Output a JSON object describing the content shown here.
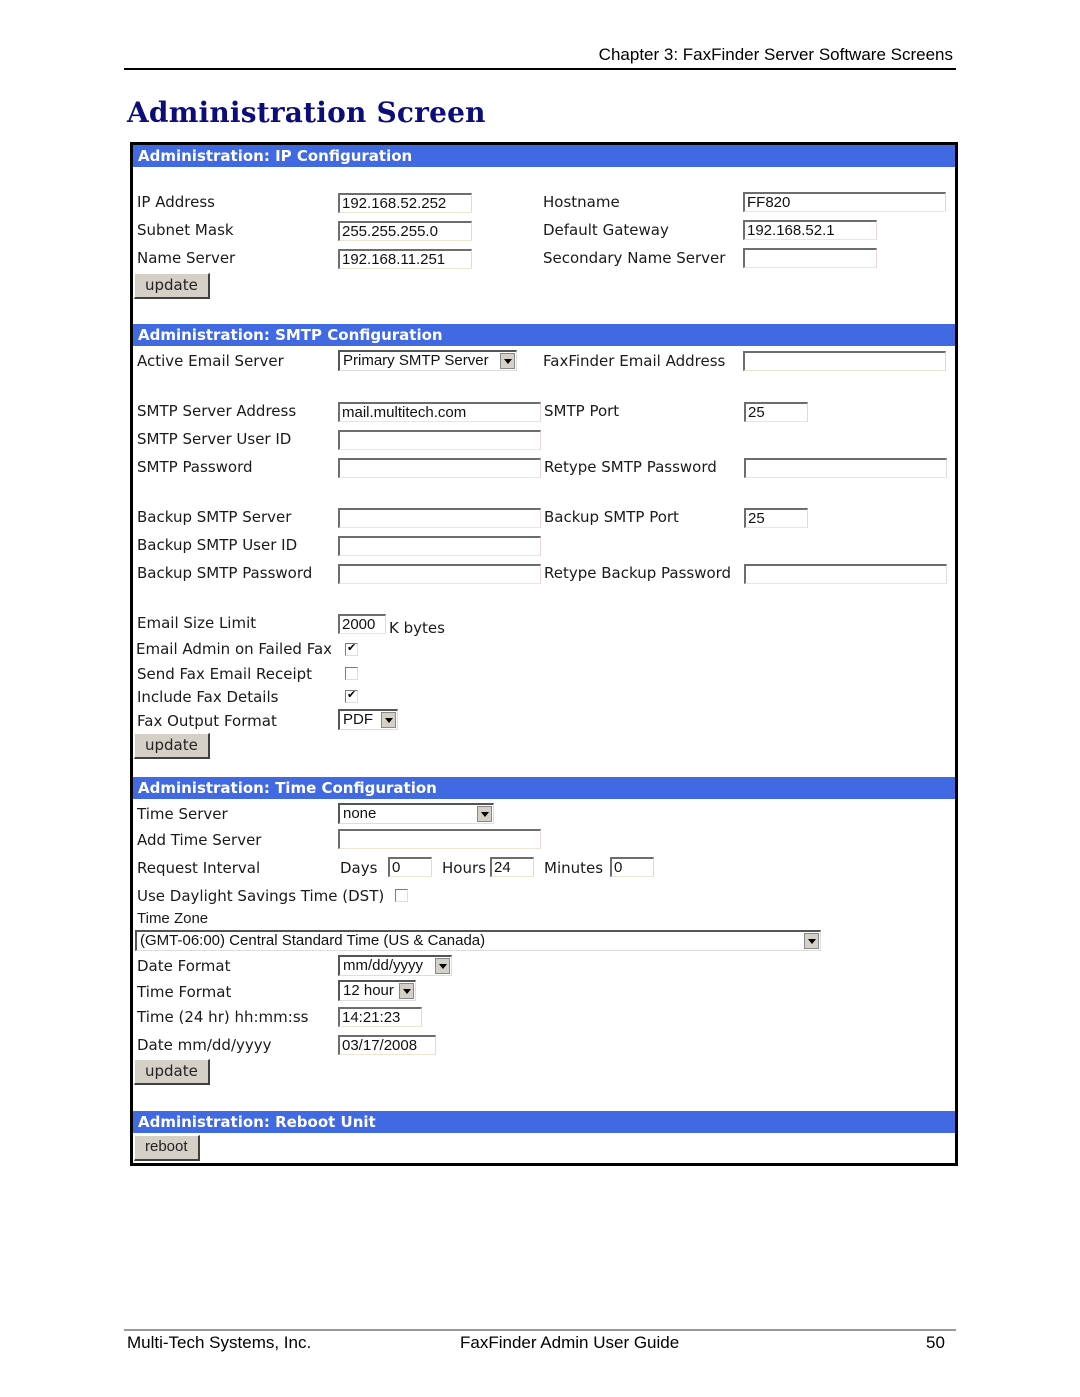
{
  "header": {
    "chapter": "Chapter 3: FaxFinder Server Software Screens"
  },
  "title": "Administration Screen",
  "ip": {
    "heading": "Administration: IP Configuration",
    "ip_address": {
      "label": "IP Address",
      "value": "192.168.52.252"
    },
    "subnet_mask": {
      "label": "Subnet Mask",
      "value": "255.255.255.0"
    },
    "name_server": {
      "label": "Name Server",
      "value": "192.168.11.251"
    },
    "hostname": {
      "label": "Hostname",
      "value": "FF820"
    },
    "default_gateway": {
      "label": "Default Gateway",
      "value": "192.168.52.1"
    },
    "secondary_name_server": {
      "label": "Secondary Name Server",
      "value": ""
    },
    "update_label": "update"
  },
  "smtp": {
    "heading": "Administration: SMTP Configuration",
    "active_email_server": {
      "label": "Active Email Server",
      "value": "Primary SMTP Server"
    },
    "faxfinder_email": {
      "label": "FaxFinder Email Address",
      "value": ""
    },
    "server_address": {
      "label": "SMTP Server Address",
      "value": "mail.multitech.com"
    },
    "port": {
      "label": "SMTP Port",
      "value": "25"
    },
    "user_id": {
      "label": "SMTP Server User ID",
      "value": ""
    },
    "password": {
      "label": "SMTP Password",
      "value": ""
    },
    "retype_password": {
      "label": "Retype SMTP Password",
      "value": ""
    },
    "backup_server": {
      "label": "Backup SMTP Server",
      "value": ""
    },
    "backup_port": {
      "label": "Backup SMTP Port",
      "value": "25"
    },
    "backup_user_id": {
      "label": "Backup SMTP User ID",
      "value": ""
    },
    "backup_password": {
      "label": "Backup SMTP Password",
      "value": ""
    },
    "retype_backup_password": {
      "label": "Retype Backup Password",
      "value": ""
    },
    "size_limit": {
      "label": "Email Size Limit",
      "value": "2000",
      "unit": "K bytes"
    },
    "email_admin_failed": {
      "label": "Email Admin on Failed Fax",
      "checked": true
    },
    "send_receipt": {
      "label": "Send Fax Email Receipt",
      "checked": false
    },
    "include_details": {
      "label": "Include Fax Details",
      "checked": true
    },
    "output_format": {
      "label": "Fax Output Format",
      "value": "PDF"
    },
    "update_label": "update"
  },
  "time": {
    "heading": "Administration: Time Configuration",
    "time_server": {
      "label": "Time Server",
      "value": "none"
    },
    "add_time_server": {
      "label": "Add Time Server",
      "value": ""
    },
    "request_interval": {
      "label": "Request Interval",
      "days_label": "Days",
      "days": "0",
      "hours_label": "Hours",
      "hours": "24",
      "minutes_label": "Minutes",
      "minutes": "0"
    },
    "dst": {
      "label": "Use Daylight Savings Time (DST)",
      "checked": false
    },
    "time_zone": {
      "label": "Time Zone",
      "value": "(GMT-06:00) Central Standard Time (US & Canada)"
    },
    "date_format": {
      "label": "Date Format",
      "value": "mm/dd/yyyy"
    },
    "time_format": {
      "label": "Time Format",
      "value": "12 hour"
    },
    "time_24": {
      "label": "Time (24 hr) hh:mm:ss",
      "value": "14:21:23"
    },
    "date": {
      "label": "Date mm/dd/yyyy",
      "value": "03/17/2008"
    },
    "update_label": "update"
  },
  "reboot": {
    "heading": "Administration: Reboot Unit",
    "button_label": "reboot"
  },
  "footer": {
    "company": "Multi-Tech Systems, Inc.",
    "guide": "FaxFinder Admin User Guide",
    "page": "50"
  }
}
